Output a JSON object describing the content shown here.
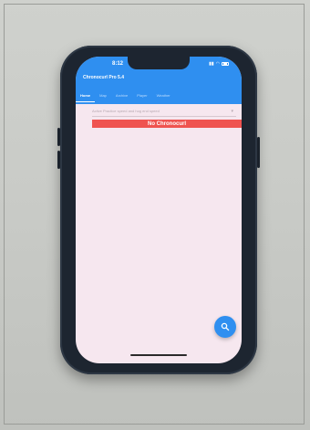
{
  "status": {
    "time": "8:12"
  },
  "app": {
    "title": "Chronocurl Pro 5.4"
  },
  "tabs": [
    {
      "label": "Home",
      "active": true
    },
    {
      "label": "Map",
      "active": false
    },
    {
      "label": "Archive",
      "active": false
    },
    {
      "label": "Player",
      "active": false
    },
    {
      "label": "Weather",
      "active": false
    }
  ],
  "dropdown": {
    "value": "Active Practice speed and hog end speed"
  },
  "banner": {
    "text": "No Chronocurl"
  },
  "fab": {
    "icon": "search-icon"
  },
  "colors": {
    "appbar": "#2f8ff0",
    "banner": "#ef5350",
    "screen_bg": "#f6e7ef"
  }
}
